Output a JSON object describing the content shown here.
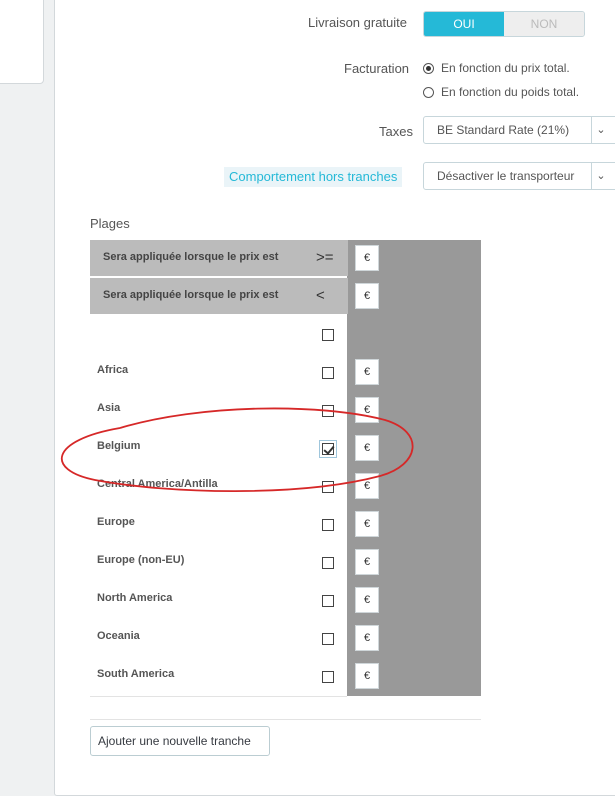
{
  "shipping": {
    "free_shipping_label": "Livraison gratuite",
    "toggle_yes": "OUI",
    "toggle_no": "NON",
    "billing_label": "Facturation",
    "billing_options": [
      "En fonction du prix total.",
      "En fonction du poids total."
    ],
    "taxes_label": "Taxes",
    "taxes_value": "BE Standard Rate (21%)",
    "out_of_range_label": "Comportement hors tranches",
    "out_of_range_value": "Désactiver le transporteur",
    "section_title": "Plages"
  },
  "ranges": {
    "header_rows": [
      {
        "text": "Sera appliquée lorsque le prix est",
        "symbol": ">="
      },
      {
        "text": "Sera appliquée lorsque le prix est",
        "symbol": "<"
      }
    ],
    "currency": "€",
    "zones": [
      {
        "name": "",
        "checked": false
      },
      {
        "name": "Africa",
        "checked": false
      },
      {
        "name": "Asia",
        "checked": false
      },
      {
        "name": "Belgium",
        "checked": true
      },
      {
        "name": "Central America/Antilla",
        "checked": false
      },
      {
        "name": "Europe",
        "checked": false
      },
      {
        "name": "Europe (non-EU)",
        "checked": false
      },
      {
        "name": "North America",
        "checked": false
      },
      {
        "name": "Oceania",
        "checked": false
      },
      {
        "name": "South America",
        "checked": false
      }
    ],
    "add_range_button": "Ajouter une nouvelle tranche"
  },
  "colors": {
    "accent": "#25b9d7",
    "annotation": "#d62828"
  }
}
